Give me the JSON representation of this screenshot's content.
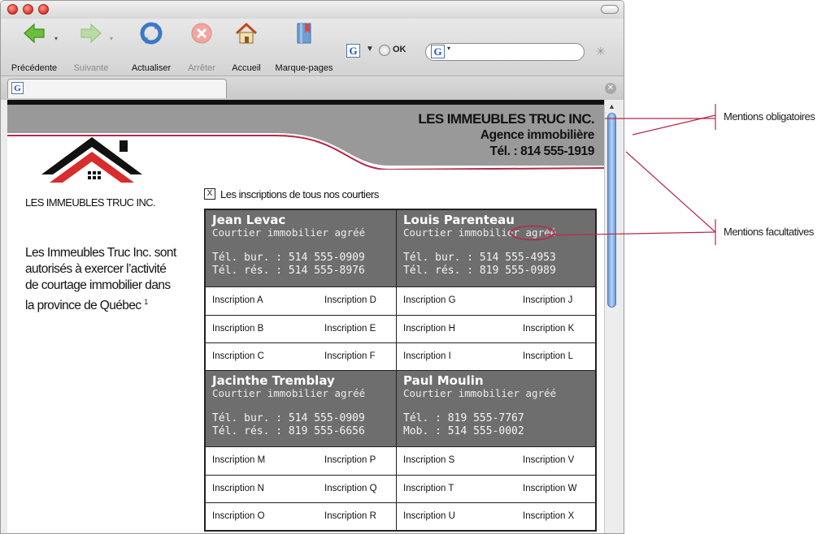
{
  "browser": {
    "toolbar": {
      "back_label": "Précédente",
      "forward_label": "Suivante",
      "reload_label": "Actualiser",
      "stop_label": "Arrêter",
      "home_label": "Accueil",
      "bookmarks_label": "Marque-pages"
    },
    "google_bar": {
      "engine_icon": "G",
      "ok_label": "OK",
      "search_engine_icon": "G"
    },
    "tab": {
      "favicon": "G"
    },
    "colors": {
      "scroll_thumb": "#6a9ad8",
      "close_button": "#d9352a"
    }
  },
  "page": {
    "header": {
      "company_name": "LES IMMEUBLES TRUC INC.",
      "company_sub": "Agence immobilière",
      "company_tel": "Tél. : 814 555-1919",
      "band_color": "#999999",
      "accent_color": "#b8284a"
    },
    "logo": {
      "text": "LES IMMEUBLES TRUC INC.",
      "roof_color": "#d92c2c"
    },
    "legal": {
      "text": "Les Immeubles Truc Inc. sont autorisés à exercer l’activité de courtage immobilier dans la province de Québec",
      "footnote": "1"
    },
    "filter": {
      "checkbox_mark": "X",
      "label": "Les inscriptions de tous nos courtiers"
    },
    "brokers": [
      {
        "name": "Jean Levac",
        "title": "Courtier immobilier agréé",
        "phone1": "Tél. bur. : 514 555-0909",
        "phone2": "Tél. rés. : 514 555-8976",
        "listings": [
          "Inscription A",
          "Inscription D",
          "Inscription B",
          "Inscription E",
          "Inscription C",
          "Inscription F"
        ]
      },
      {
        "name": "Louis Parenteau",
        "title": "Courtier immobilier agréé",
        "phone1": "Tél. bur. : 514 555-4953",
        "phone2": "Tél. rés. : 819 555-0989",
        "listings": [
          "Inscription G",
          "Inscription J",
          "Inscription H",
          "Inscription K",
          "Inscription I",
          "Inscription L"
        ]
      },
      {
        "name": "Jacinthe Tremblay",
        "title": "Courtier immobilier agréé",
        "phone1": "Tél. bur. : 514 555-0909",
        "phone2": "Tél. rés. : 819 555-6656",
        "listings": [
          "Inscription M",
          "Inscription P",
          "Inscription N",
          "Inscription Q",
          "Inscription O",
          "Inscription R"
        ]
      },
      {
        "name": "Paul Moulin",
        "title": "Courtier immobilier agréé",
        "phone1": "Tél. : 819 555-7767",
        "phone2": "Mob. : 514 555-0002",
        "listings": [
          "Inscription S",
          "Inscription V",
          "Inscription T",
          "Inscription W",
          "Inscription U",
          "Inscription X"
        ]
      }
    ]
  },
  "annotations": {
    "mandatory": "Mentions obligatoires",
    "optional": "Mentions facultatives",
    "color": "#b8284a"
  }
}
